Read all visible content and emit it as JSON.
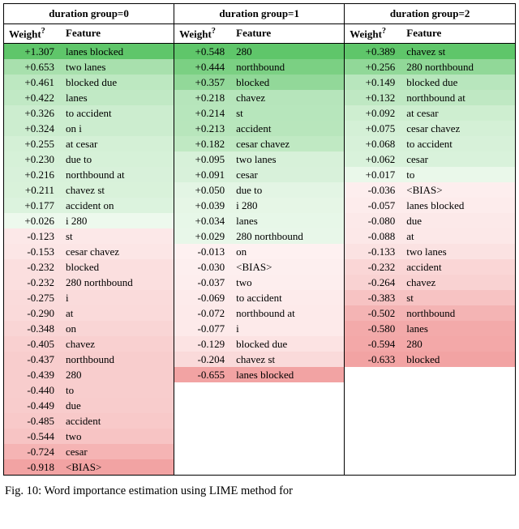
{
  "chart_data": {
    "type": "table",
    "title": "Word importance estimation using LIME method for",
    "columns_per_group": [
      "Weight?",
      "Feature"
    ],
    "color_scale": {
      "pos_max": "#5fc66a",
      "pos_min": "#f0faf0",
      "neg_min": "#fef3f3",
      "neg_max": "#f2a3a3"
    },
    "groups": [
      {
        "title": "duration group=0",
        "rows": [
          {
            "weight": 1.307,
            "feature": "lanes blocked"
          },
          {
            "weight": 0.653,
            "feature": "two lanes"
          },
          {
            "weight": 0.461,
            "feature": "blocked due"
          },
          {
            "weight": 0.422,
            "feature": "lanes"
          },
          {
            "weight": 0.326,
            "feature": "to accident"
          },
          {
            "weight": 0.324,
            "feature": "on i"
          },
          {
            "weight": 0.255,
            "feature": "at cesar"
          },
          {
            "weight": 0.23,
            "feature": "due to"
          },
          {
            "weight": 0.216,
            "feature": "northbound at"
          },
          {
            "weight": 0.211,
            "feature": "chavez st"
          },
          {
            "weight": 0.177,
            "feature": "accident on"
          },
          {
            "weight": 0.026,
            "feature": "i 280"
          },
          {
            "weight": -0.123,
            "feature": "st"
          },
          {
            "weight": -0.153,
            "feature": "cesar chavez"
          },
          {
            "weight": -0.232,
            "feature": "blocked"
          },
          {
            "weight": -0.232,
            "feature": "280 northbound"
          },
          {
            "weight": -0.275,
            "feature": "i"
          },
          {
            "weight": -0.29,
            "feature": "at"
          },
          {
            "weight": -0.348,
            "feature": "on"
          },
          {
            "weight": -0.405,
            "feature": "chavez"
          },
          {
            "weight": -0.437,
            "feature": "northbound"
          },
          {
            "weight": -0.439,
            "feature": "280"
          },
          {
            "weight": -0.44,
            "feature": "to"
          },
          {
            "weight": -0.449,
            "feature": "due"
          },
          {
            "weight": -0.485,
            "feature": "accident"
          },
          {
            "weight": -0.544,
            "feature": "two"
          },
          {
            "weight": -0.724,
            "feature": "cesar"
          },
          {
            "weight": -0.918,
            "feature": "<BIAS>"
          }
        ]
      },
      {
        "title": "duration group=1",
        "rows": [
          {
            "weight": 0.548,
            "feature": "280"
          },
          {
            "weight": 0.444,
            "feature": "northbound"
          },
          {
            "weight": 0.357,
            "feature": "blocked"
          },
          {
            "weight": 0.218,
            "feature": "chavez"
          },
          {
            "weight": 0.214,
            "feature": "st"
          },
          {
            "weight": 0.213,
            "feature": "accident"
          },
          {
            "weight": 0.182,
            "feature": "cesar chavez"
          },
          {
            "weight": 0.095,
            "feature": "two lanes"
          },
          {
            "weight": 0.091,
            "feature": "cesar"
          },
          {
            "weight": 0.05,
            "feature": "due to"
          },
          {
            "weight": 0.039,
            "feature": "i 280"
          },
          {
            "weight": 0.034,
            "feature": "lanes"
          },
          {
            "weight": 0.029,
            "feature": "280 northbound"
          },
          {
            "weight": -0.013,
            "feature": "on"
          },
          {
            "weight": -0.03,
            "feature": "<BIAS>"
          },
          {
            "weight": -0.037,
            "feature": "two"
          },
          {
            "weight": -0.069,
            "feature": "to accident"
          },
          {
            "weight": -0.072,
            "feature": "northbound at"
          },
          {
            "weight": -0.077,
            "feature": "i"
          },
          {
            "weight": -0.129,
            "feature": "blocked due"
          },
          {
            "weight": -0.204,
            "feature": "chavez st"
          },
          {
            "weight": -0.655,
            "feature": "lanes blocked"
          }
        ]
      },
      {
        "title": "duration group=2",
        "rows": [
          {
            "weight": 0.389,
            "feature": "chavez st"
          },
          {
            "weight": 0.256,
            "feature": "280 northbound"
          },
          {
            "weight": 0.149,
            "feature": "blocked due"
          },
          {
            "weight": 0.132,
            "feature": "northbound at"
          },
          {
            "weight": 0.092,
            "feature": "at cesar"
          },
          {
            "weight": 0.075,
            "feature": "cesar chavez"
          },
          {
            "weight": 0.068,
            "feature": "to accident"
          },
          {
            "weight": 0.062,
            "feature": "cesar"
          },
          {
            "weight": 0.017,
            "feature": "to"
          },
          {
            "weight": -0.036,
            "feature": "<BIAS>"
          },
          {
            "weight": -0.057,
            "feature": "lanes blocked"
          },
          {
            "weight": -0.08,
            "feature": "due"
          },
          {
            "weight": -0.088,
            "feature": "at"
          },
          {
            "weight": -0.133,
            "feature": "two lanes"
          },
          {
            "weight": -0.232,
            "feature": "accident"
          },
          {
            "weight": -0.264,
            "feature": "chavez"
          },
          {
            "weight": -0.383,
            "feature": "st"
          },
          {
            "weight": -0.502,
            "feature": "northbound"
          },
          {
            "weight": -0.58,
            "feature": "lanes"
          },
          {
            "weight": -0.594,
            "feature": "280"
          },
          {
            "weight": -0.633,
            "feature": "blocked"
          }
        ]
      }
    ]
  },
  "header_weight_label": "Weight",
  "header_weight_sup": "?",
  "header_feature_label": "Feature",
  "caption_prefix": "Fig. 10: ",
  "caption_text": "Word importance estimation using LIME method for"
}
